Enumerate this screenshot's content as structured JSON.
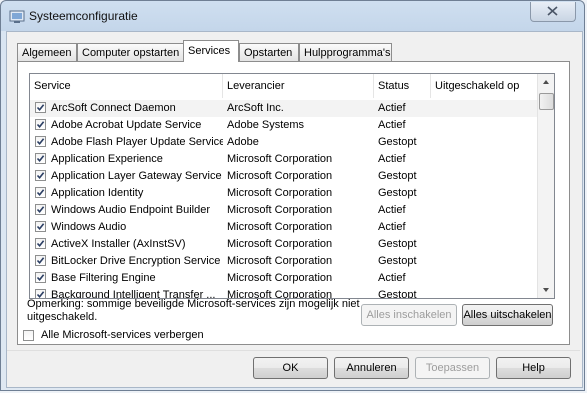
{
  "window": {
    "title": "Systeemconfiguratie"
  },
  "tabs": [
    {
      "label": "Algemeen"
    },
    {
      "label": "Computer opstarten"
    },
    {
      "label": "Services"
    },
    {
      "label": "Opstarten"
    },
    {
      "label": "Hulpprogramma's"
    }
  ],
  "active_tab": "Services",
  "columns": [
    "Service",
    "Leverancier",
    "Status",
    "Uitgeschakeld op"
  ],
  "services": [
    {
      "name": "ArcSoft Connect Daemon",
      "vendor": "ArcSoft Inc.",
      "status": "Actief",
      "disabled_on": "",
      "checked": true
    },
    {
      "name": "Adobe Acrobat Update Service",
      "vendor": "Adobe Systems",
      "status": "Actief",
      "disabled_on": "",
      "checked": true
    },
    {
      "name": "Adobe Flash Player Update Service",
      "vendor": "Adobe",
      "status": "Gestopt",
      "disabled_on": "",
      "checked": true
    },
    {
      "name": "Application Experience",
      "vendor": "Microsoft Corporation",
      "status": "Actief",
      "disabled_on": "",
      "checked": true
    },
    {
      "name": "Application Layer Gateway Service",
      "vendor": "Microsoft Corporation",
      "status": "Gestopt",
      "disabled_on": "",
      "checked": true
    },
    {
      "name": "Application Identity",
      "vendor": "Microsoft Corporation",
      "status": "Gestopt",
      "disabled_on": "",
      "checked": true
    },
    {
      "name": "Windows Audio Endpoint Builder",
      "vendor": "Microsoft Corporation",
      "status": "Actief",
      "disabled_on": "",
      "checked": true
    },
    {
      "name": "Windows Audio",
      "vendor": "Microsoft Corporation",
      "status": "Actief",
      "disabled_on": "",
      "checked": true
    },
    {
      "name": "ActiveX Installer (AxInstSV)",
      "vendor": "Microsoft Corporation",
      "status": "Gestopt",
      "disabled_on": "",
      "checked": true
    },
    {
      "name": "BitLocker Drive Encryption Service",
      "vendor": "Microsoft Corporation",
      "status": "Gestopt",
      "disabled_on": "",
      "checked": true
    },
    {
      "name": "Base Filtering Engine",
      "vendor": "Microsoft Corporation",
      "status": "Actief",
      "disabled_on": "",
      "checked": true
    },
    {
      "name": "Background Intelligent Transfer ...",
      "vendor": "Microsoft Corporation",
      "status": "Gestopt",
      "disabled_on": "",
      "checked": true
    }
  ],
  "note": "Opmerking: sommige beveiligde Microsoft-services zijn mogelijk niet uitgeschakeld.",
  "buttons": {
    "enable_all": "Alles inschakelen",
    "disable_all": "Alles uitschakelen",
    "ok": "OK",
    "cancel": "Annuleren",
    "apply": "Toepassen",
    "help": "Help"
  },
  "hide_ms": {
    "label": "Alle Microsoft-services verbergen",
    "checked": false
  },
  "colors": {
    "selection": "#f3f3f3",
    "border": "#828790",
    "titlebar": "#c4d6ea"
  },
  "icons": {
    "title": "msconfig-icon",
    "close": "close-icon",
    "check": "checkmark-icon"
  }
}
